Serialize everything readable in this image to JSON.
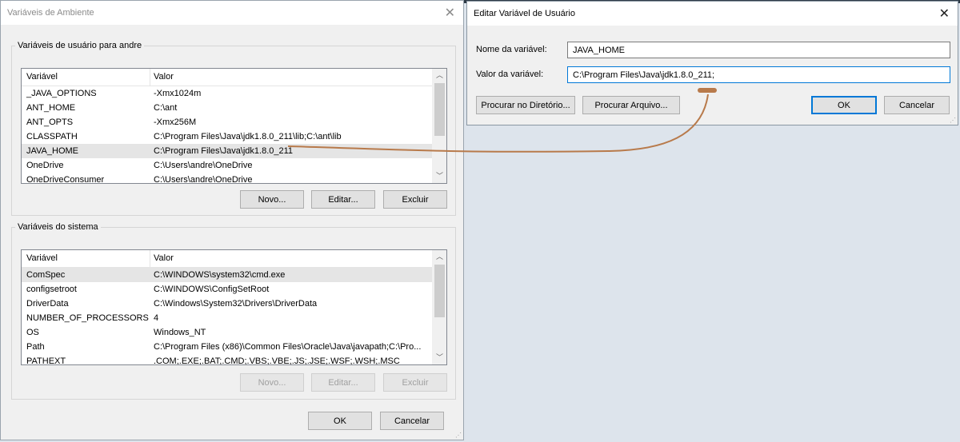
{
  "main_dialog": {
    "title": "Variáveis de Ambiente",
    "user_group": {
      "label": "Variáveis de usuário para andre",
      "columns": [
        "Variável",
        "Valor"
      ],
      "rows": [
        {
          "name": "_JAVA_OPTIONS",
          "value": "-Xmx1024m"
        },
        {
          "name": "ANT_HOME",
          "value": "C:\\ant"
        },
        {
          "name": "ANT_OPTS",
          "value": "-Xmx256M"
        },
        {
          "name": "CLASSPATH",
          "value": "C:\\Program Files\\Java\\jdk1.8.0_211\\lib;C:\\ant\\lib"
        },
        {
          "name": "JAVA_HOME",
          "value": "C:\\Program Files\\Java\\jdk1.8.0_211"
        },
        {
          "name": "OneDrive",
          "value": "C:\\Users\\andre\\OneDrive"
        },
        {
          "name": "OneDriveConsumer",
          "value": "C:\\Users\\andre\\OneDrive"
        }
      ],
      "selected_row": "JAVA_HOME",
      "buttons": {
        "new": "Novo...",
        "edit": "Editar...",
        "delete": "Excluir"
      }
    },
    "system_group": {
      "label": "Variáveis do sistema",
      "columns": [
        "Variável",
        "Valor"
      ],
      "rows": [
        {
          "name": "ComSpec",
          "value": "C:\\WINDOWS\\system32\\cmd.exe"
        },
        {
          "name": "configsetroot",
          "value": "C:\\WINDOWS\\ConfigSetRoot"
        },
        {
          "name": "DriverData",
          "value": "C:\\Windows\\System32\\Drivers\\DriverData"
        },
        {
          "name": "NUMBER_OF_PROCESSORS",
          "value": "4"
        },
        {
          "name": "OS",
          "value": "Windows_NT"
        },
        {
          "name": "Path",
          "value": "C:\\Program Files (x86)\\Common Files\\Oracle\\Java\\javapath;C:\\Pro..."
        },
        {
          "name": "PATHEXT",
          "value": ".COM;.EXE;.BAT;.CMD;.VBS;.VBE;.JS;.JSE;.WSF;.WSH;.MSC"
        }
      ],
      "selected_row": "ComSpec",
      "buttons": {
        "new": "Novo...",
        "edit": "Editar...",
        "delete": "Excluir"
      }
    },
    "ok": "OK",
    "cancel": "Cancelar"
  },
  "edit_dialog": {
    "title": "Editar Variável de Usuário",
    "name_label": "Nome da variável:",
    "name_value": "JAVA_HOME",
    "value_label": "Valor da variável:",
    "value_value": "C:\\Program Files\\Java\\jdk1.8.0_211;",
    "browse_dir": "Procurar no Diretório...",
    "browse_file": "Procurar Arquivo...",
    "ok": "OK",
    "cancel": "Cancelar"
  },
  "colors": {
    "accent": "#0078d7",
    "annotation_arrow": "#b87a4b",
    "selection": "#e5e5e5"
  }
}
